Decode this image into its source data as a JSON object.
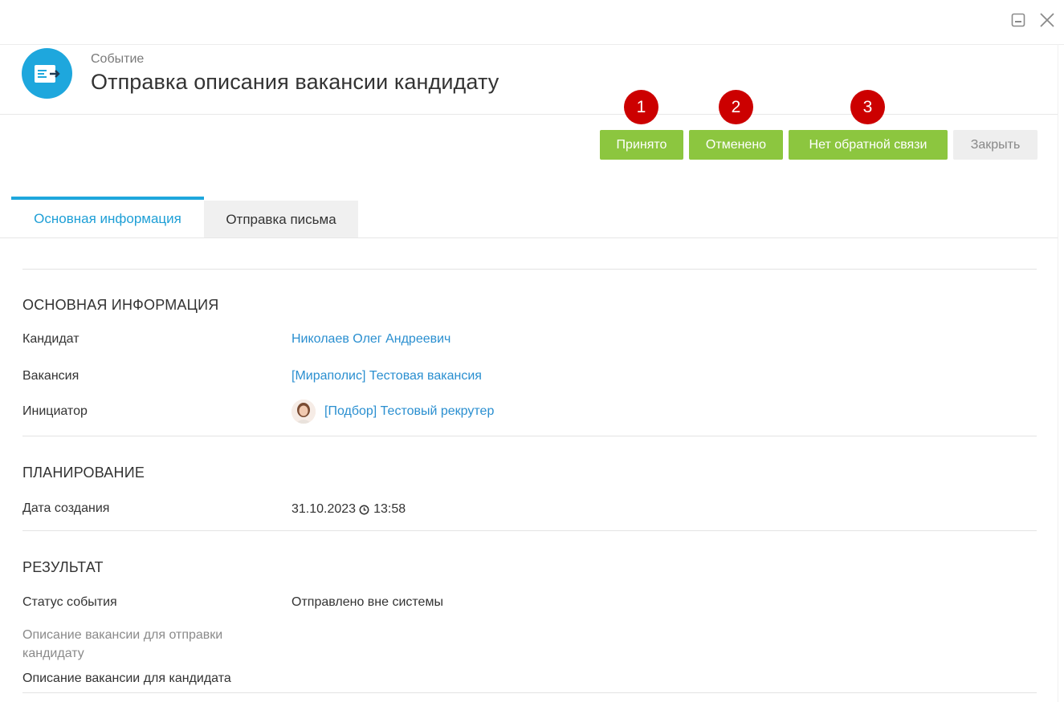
{
  "window": {
    "minimize_icon": "minimize-icon",
    "close_icon": "close-icon"
  },
  "header": {
    "icon": "event-ticket-icon",
    "subtitle": "Событие",
    "title": "Отправка описания вакансии кандидату"
  },
  "actions": {
    "accepted": "Принято",
    "cancelled": "Отменено",
    "no_feedback": "Нет обратной связи",
    "close": "Закрыть"
  },
  "badges": [
    "1",
    "2",
    "3"
  ],
  "tabs": [
    {
      "label": "Основная информация",
      "active": true
    },
    {
      "label": "Отправка письма",
      "active": false
    }
  ],
  "sections": {
    "main": {
      "title": "ОСНОВНАЯ ИНФОРМАЦИЯ",
      "candidate_label": "Кандидат",
      "candidate_value": "Николаев Олег Андреевич",
      "vacancy_label": "Вакансия",
      "vacancy_value": "[Мираполис] Тестовая вакансия",
      "initiator_label": "Инициатор",
      "initiator_value": "[Подбор] Тестовый рекрутер"
    },
    "planning": {
      "title": "ПЛАНИРОВАНИЕ",
      "created_label": "Дата создания",
      "created_date": "31.10.2023",
      "created_time": "13:58"
    },
    "result": {
      "title": "РЕЗУЛЬТАТ",
      "status_label": "Статус события",
      "status_value": "Отправлено вне системы",
      "desc_send_label": "Описание вакансии для отправки кандидату",
      "desc_candidate_label": "Описание вакансии для кандидата"
    }
  },
  "colors": {
    "accent": "#1ea7dd",
    "link": "#2a8fd0",
    "green_button": "#8cc63f",
    "badge": "#cc0000"
  }
}
